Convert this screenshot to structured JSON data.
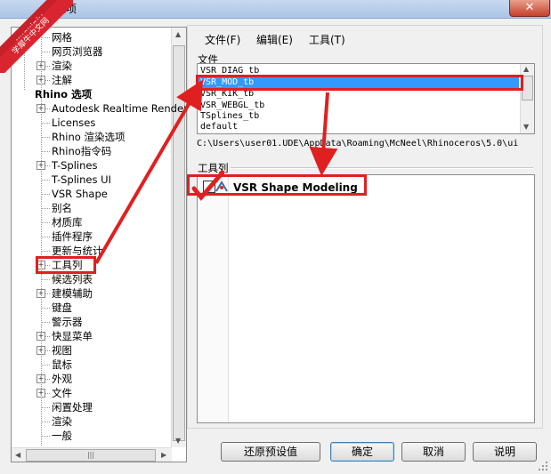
{
  "window": {
    "title": "选项",
    "close_glyph": "✕"
  },
  "watermark": {
    "line1": "xuexiniu",
    "line2": "学犀牛中文网"
  },
  "tree": {
    "items": [
      {
        "label": "网格",
        "level": 2,
        "expander": false
      },
      {
        "label": "网页浏览器",
        "level": 2,
        "expander": false
      },
      {
        "label": "渲染",
        "level": 2,
        "expander": true
      },
      {
        "label": "注解",
        "level": 2,
        "expander": true
      },
      {
        "label": "Rhino 选项",
        "level": 1,
        "expander": false,
        "bold": true
      },
      {
        "label": "Autodesk Realtime Renderer",
        "level": 2,
        "expander": true
      },
      {
        "label": "Licenses",
        "level": 2,
        "expander": false
      },
      {
        "label": "Rhino 渲染选项",
        "level": 2,
        "expander": false
      },
      {
        "label": "Rhino指令码",
        "level": 2,
        "expander": false
      },
      {
        "label": "T-Splines",
        "level": 2,
        "expander": true
      },
      {
        "label": "T-Splines UI",
        "level": 2,
        "expander": false
      },
      {
        "label": "VSR Shape",
        "level": 2,
        "expander": false
      },
      {
        "label": "别名",
        "level": 2,
        "expander": false
      },
      {
        "label": "材质库",
        "level": 2,
        "expander": false
      },
      {
        "label": "插件程序",
        "level": 2,
        "expander": false
      },
      {
        "label": "更新与统计",
        "level": 2,
        "expander": false
      },
      {
        "label": "工具列",
        "level": 2,
        "expander": true
      },
      {
        "label": "候选列表",
        "level": 2,
        "expander": false
      },
      {
        "label": "建模辅助",
        "level": 2,
        "expander": true
      },
      {
        "label": "键盘",
        "level": 2,
        "expander": false
      },
      {
        "label": "警示器",
        "level": 2,
        "expander": false
      },
      {
        "label": "快显菜单",
        "level": 2,
        "expander": true
      },
      {
        "label": "视图",
        "level": 2,
        "expander": true
      },
      {
        "label": "鼠标",
        "level": 2,
        "expander": false
      },
      {
        "label": "外观",
        "level": 2,
        "expander": true
      },
      {
        "label": "文件",
        "level": 2,
        "expander": true
      },
      {
        "label": "闲置处理",
        "level": 2,
        "expander": false
      },
      {
        "label": "渲染",
        "level": 2,
        "expander": false
      },
      {
        "label": "一般",
        "level": 2,
        "expander": false
      }
    ]
  },
  "menu": {
    "file": "文件(F)",
    "edit": "编辑(E)",
    "tools": "工具(T)"
  },
  "files_group": {
    "label": "文件",
    "items": [
      "VSR_DIAG_tb",
      "VSR_MOD_tb",
      "VSR_KIK_tb",
      "VSR_WEBGL_tb",
      "TSplines_tb",
      "default"
    ],
    "selected_index": 1,
    "path": "C:\\Users\\user01.UDE\\AppData\\Roaming\\McNeel\\Rhinoceros\\5.0\\ui"
  },
  "toolbars_group": {
    "label": "工具列",
    "items": [
      {
        "label": "VSR Shape Modeling",
        "checked": true
      }
    ]
  },
  "buttons": {
    "restore": "还原预设值",
    "ok": "确定",
    "cancel": "取消",
    "help": "说明"
  },
  "colors": {
    "selection": "#3399ff",
    "annotation": "#e02020",
    "watermark": "#c8202a"
  }
}
